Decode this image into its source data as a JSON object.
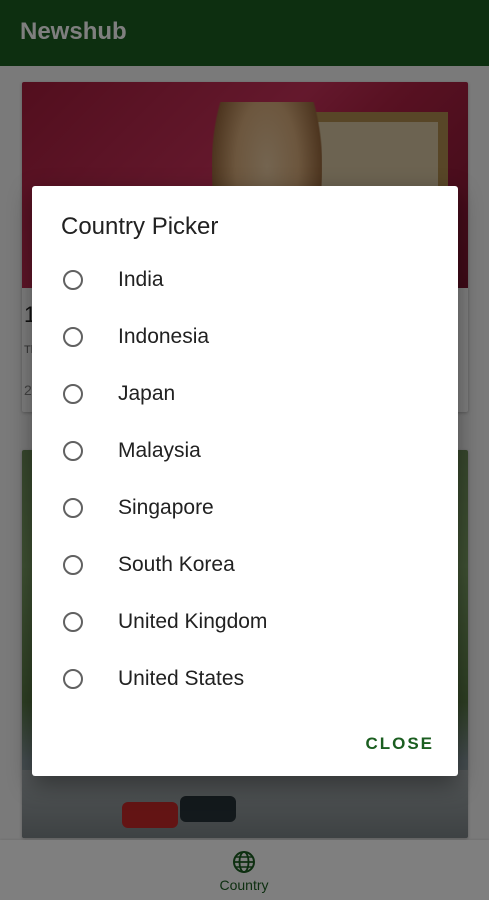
{
  "app": {
    "title": "Newshub"
  },
  "cards": [
    {
      "headline_fragment": "1",
      "subline_fragment": "The",
      "date_fragment": "2"
    },
    {}
  ],
  "bottom_nav": {
    "items": [
      {
        "label": "Country",
        "icon": "globe-icon"
      }
    ]
  },
  "dialog": {
    "title": "Country Picker",
    "options": [
      {
        "label": "India",
        "selected": false
      },
      {
        "label": "Indonesia",
        "selected": false
      },
      {
        "label": "Japan",
        "selected": false
      },
      {
        "label": "Malaysia",
        "selected": false
      },
      {
        "label": "Singapore",
        "selected": false
      },
      {
        "label": "South Korea",
        "selected": false
      },
      {
        "label": "United Kingdom",
        "selected": false
      },
      {
        "label": "United States",
        "selected": false
      }
    ],
    "close_label": "CLOSE"
  },
  "colors": {
    "primary": "#1b5e20",
    "scrim": "rgba(0,0,0,0.5)"
  }
}
